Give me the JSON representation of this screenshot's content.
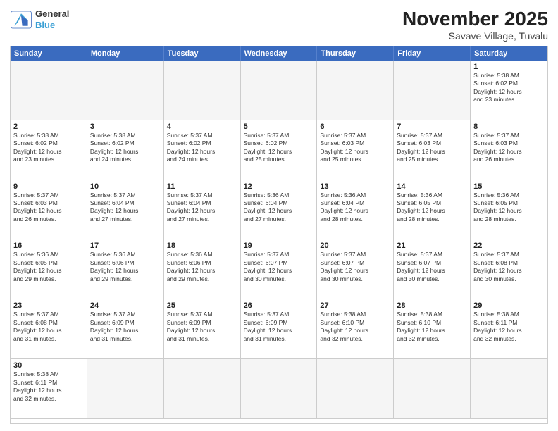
{
  "header": {
    "logo_line1": "General",
    "logo_line2": "Blue",
    "main_title": "November 2025",
    "sub_title": "Savave Village, Tuvalu"
  },
  "weekdays": [
    "Sunday",
    "Monday",
    "Tuesday",
    "Wednesday",
    "Thursday",
    "Friday",
    "Saturday"
  ],
  "cells": [
    {
      "day": "",
      "info": "",
      "empty": true
    },
    {
      "day": "",
      "info": "",
      "empty": true
    },
    {
      "day": "",
      "info": "",
      "empty": true
    },
    {
      "day": "",
      "info": "",
      "empty": true
    },
    {
      "day": "",
      "info": "",
      "empty": true
    },
    {
      "day": "",
      "info": "",
      "empty": true
    },
    {
      "day": "1",
      "info": "Sunrise: 5:38 AM\nSunset: 6:02 PM\nDaylight: 12 hours\nand 23 minutes.",
      "empty": false
    },
    {
      "day": "2",
      "info": "Sunrise: 5:38 AM\nSunset: 6:02 PM\nDaylight: 12 hours\nand 23 minutes.",
      "empty": false
    },
    {
      "day": "3",
      "info": "Sunrise: 5:38 AM\nSunset: 6:02 PM\nDaylight: 12 hours\nand 24 minutes.",
      "empty": false
    },
    {
      "day": "4",
      "info": "Sunrise: 5:37 AM\nSunset: 6:02 PM\nDaylight: 12 hours\nand 24 minutes.",
      "empty": false
    },
    {
      "day": "5",
      "info": "Sunrise: 5:37 AM\nSunset: 6:02 PM\nDaylight: 12 hours\nand 25 minutes.",
      "empty": false
    },
    {
      "day": "6",
      "info": "Sunrise: 5:37 AM\nSunset: 6:03 PM\nDaylight: 12 hours\nand 25 minutes.",
      "empty": false
    },
    {
      "day": "7",
      "info": "Sunrise: 5:37 AM\nSunset: 6:03 PM\nDaylight: 12 hours\nand 25 minutes.",
      "empty": false
    },
    {
      "day": "8",
      "info": "Sunrise: 5:37 AM\nSunset: 6:03 PM\nDaylight: 12 hours\nand 26 minutes.",
      "empty": false
    },
    {
      "day": "9",
      "info": "Sunrise: 5:37 AM\nSunset: 6:03 PM\nDaylight: 12 hours\nand 26 minutes.",
      "empty": false
    },
    {
      "day": "10",
      "info": "Sunrise: 5:37 AM\nSunset: 6:04 PM\nDaylight: 12 hours\nand 27 minutes.",
      "empty": false
    },
    {
      "day": "11",
      "info": "Sunrise: 5:37 AM\nSunset: 6:04 PM\nDaylight: 12 hours\nand 27 minutes.",
      "empty": false
    },
    {
      "day": "12",
      "info": "Sunrise: 5:36 AM\nSunset: 6:04 PM\nDaylight: 12 hours\nand 27 minutes.",
      "empty": false
    },
    {
      "day": "13",
      "info": "Sunrise: 5:36 AM\nSunset: 6:04 PM\nDaylight: 12 hours\nand 28 minutes.",
      "empty": false
    },
    {
      "day": "14",
      "info": "Sunrise: 5:36 AM\nSunset: 6:05 PM\nDaylight: 12 hours\nand 28 minutes.",
      "empty": false
    },
    {
      "day": "15",
      "info": "Sunrise: 5:36 AM\nSunset: 6:05 PM\nDaylight: 12 hours\nand 28 minutes.",
      "empty": false
    },
    {
      "day": "16",
      "info": "Sunrise: 5:36 AM\nSunset: 6:05 PM\nDaylight: 12 hours\nand 29 minutes.",
      "empty": false
    },
    {
      "day": "17",
      "info": "Sunrise: 5:36 AM\nSunset: 6:06 PM\nDaylight: 12 hours\nand 29 minutes.",
      "empty": false
    },
    {
      "day": "18",
      "info": "Sunrise: 5:36 AM\nSunset: 6:06 PM\nDaylight: 12 hours\nand 29 minutes.",
      "empty": false
    },
    {
      "day": "19",
      "info": "Sunrise: 5:37 AM\nSunset: 6:07 PM\nDaylight: 12 hours\nand 30 minutes.",
      "empty": false
    },
    {
      "day": "20",
      "info": "Sunrise: 5:37 AM\nSunset: 6:07 PM\nDaylight: 12 hours\nand 30 minutes.",
      "empty": false
    },
    {
      "day": "21",
      "info": "Sunrise: 5:37 AM\nSunset: 6:07 PM\nDaylight: 12 hours\nand 30 minutes.",
      "empty": false
    },
    {
      "day": "22",
      "info": "Sunrise: 5:37 AM\nSunset: 6:08 PM\nDaylight: 12 hours\nand 30 minutes.",
      "empty": false
    },
    {
      "day": "23",
      "info": "Sunrise: 5:37 AM\nSunset: 6:08 PM\nDaylight: 12 hours\nand 31 minutes.",
      "empty": false
    },
    {
      "day": "24",
      "info": "Sunrise: 5:37 AM\nSunset: 6:09 PM\nDaylight: 12 hours\nand 31 minutes.",
      "empty": false
    },
    {
      "day": "25",
      "info": "Sunrise: 5:37 AM\nSunset: 6:09 PM\nDaylight: 12 hours\nand 31 minutes.",
      "empty": false
    },
    {
      "day": "26",
      "info": "Sunrise: 5:37 AM\nSunset: 6:09 PM\nDaylight: 12 hours\nand 31 minutes.",
      "empty": false
    },
    {
      "day": "27",
      "info": "Sunrise: 5:38 AM\nSunset: 6:10 PM\nDaylight: 12 hours\nand 32 minutes.",
      "empty": false
    },
    {
      "day": "28",
      "info": "Sunrise: 5:38 AM\nSunset: 6:10 PM\nDaylight: 12 hours\nand 32 minutes.",
      "empty": false
    },
    {
      "day": "29",
      "info": "Sunrise: 5:38 AM\nSunset: 6:11 PM\nDaylight: 12 hours\nand 32 minutes.",
      "empty": false
    },
    {
      "day": "30",
      "info": "Sunrise: 5:38 AM\nSunset: 6:11 PM\nDaylight: 12 hours\nand 32 minutes.",
      "empty": false
    },
    {
      "day": "",
      "info": "",
      "empty": true
    },
    {
      "day": "",
      "info": "",
      "empty": true
    },
    {
      "day": "",
      "info": "",
      "empty": true
    },
    {
      "day": "",
      "info": "",
      "empty": true
    },
    {
      "day": "",
      "info": "",
      "empty": true
    },
    {
      "day": "",
      "info": "",
      "empty": true
    }
  ]
}
